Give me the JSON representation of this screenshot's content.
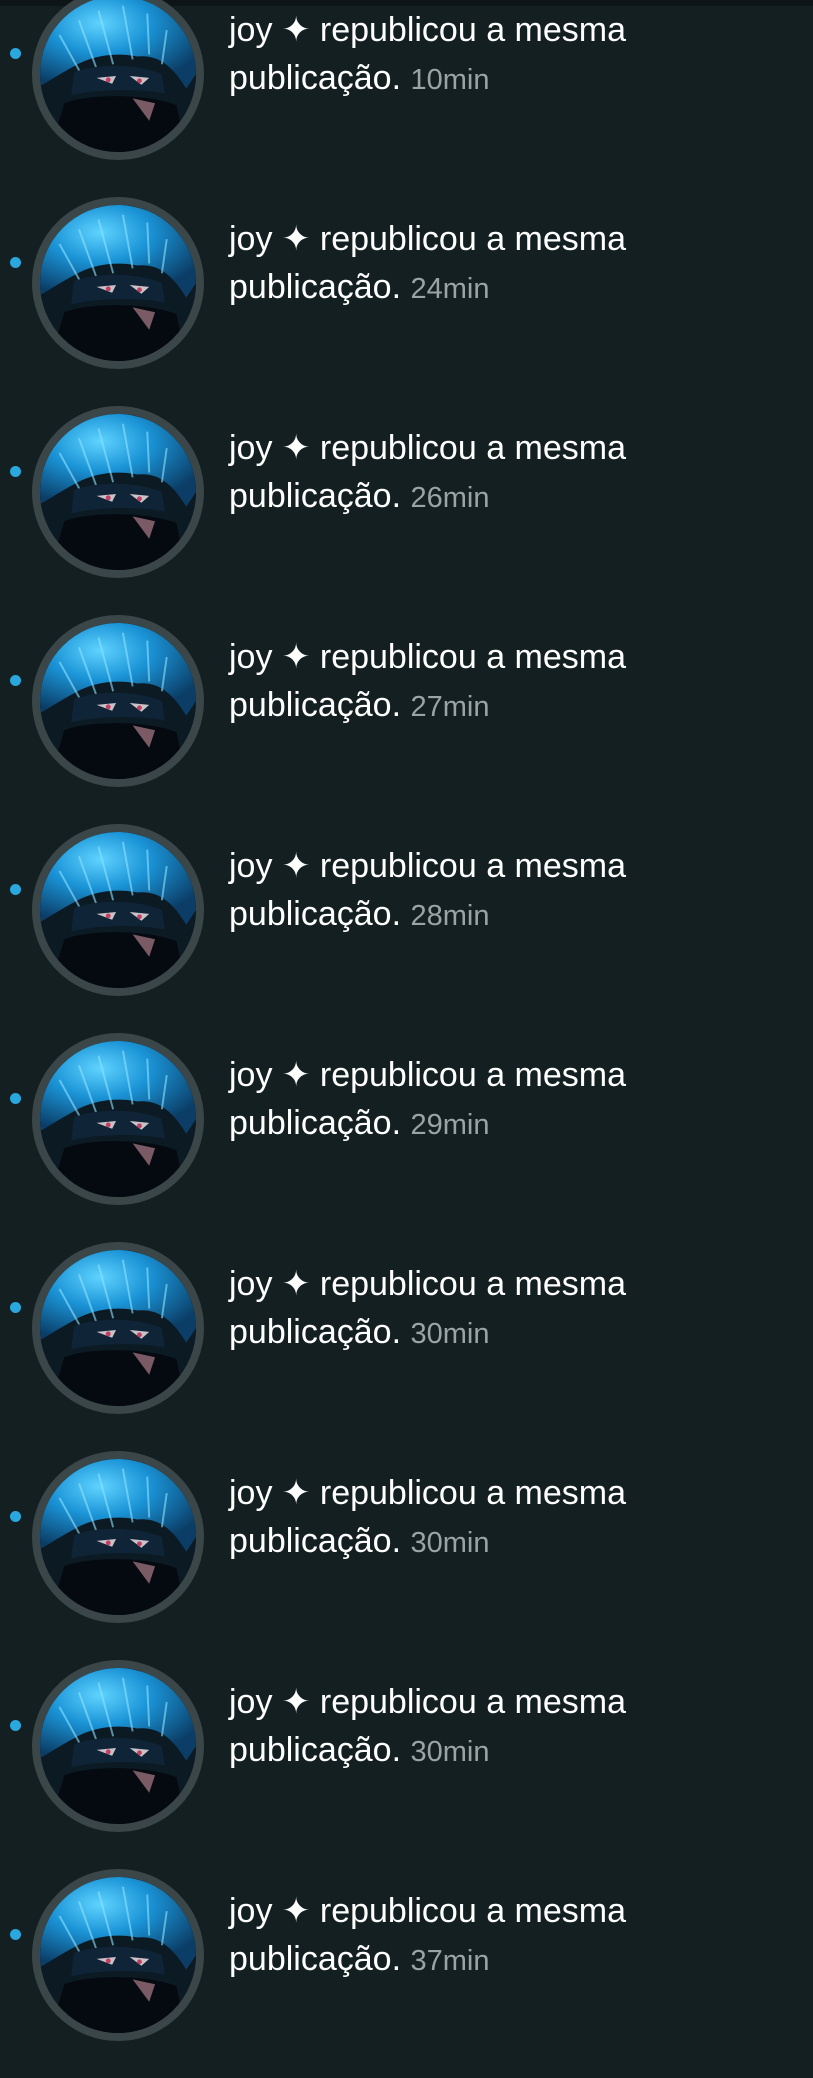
{
  "colors": {
    "background": "#141f21",
    "unread_dot": "#2aa7dc",
    "avatar_ring": "#3a4648",
    "text": "#ffffff",
    "timestamp": "#9aa3a5"
  },
  "notifications": [
    {
      "actor": "joy",
      "star": "✦",
      "action": " republicou a mesma",
      "object": "publicação.",
      "time": "10min",
      "unread": true,
      "avatar": "profile-avatar-icon"
    },
    {
      "actor": "joy",
      "star": "✦",
      "action": " republicou a mesma",
      "object": "publicação.",
      "time": "24min",
      "unread": true,
      "avatar": "profile-avatar-icon"
    },
    {
      "actor": "joy",
      "star": "✦",
      "action": " republicou a mesma",
      "object": "publicação.",
      "time": "26min",
      "unread": true,
      "avatar": "profile-avatar-icon"
    },
    {
      "actor": "joy",
      "star": "✦",
      "action": " republicou a mesma",
      "object": "publicação.",
      "time": "27min",
      "unread": true,
      "avatar": "profile-avatar-icon"
    },
    {
      "actor": "joy",
      "star": "✦",
      "action": " republicou a mesma",
      "object": "publicação.",
      "time": "28min",
      "unread": true,
      "avatar": "profile-avatar-icon"
    },
    {
      "actor": "joy",
      "star": "✦",
      "action": " republicou a mesma",
      "object": "publicação.",
      "time": "29min",
      "unread": true,
      "avatar": "profile-avatar-icon"
    },
    {
      "actor": "joy",
      "star": "✦",
      "action": " republicou a mesma",
      "object": "publicação.",
      "time": "30min",
      "unread": true,
      "avatar": "profile-avatar-icon"
    },
    {
      "actor": "joy",
      "star": "✦",
      "action": " republicou a mesma",
      "object": "publicação.",
      "time": "30min",
      "unread": true,
      "avatar": "profile-avatar-icon"
    },
    {
      "actor": "joy",
      "star": "✦",
      "action": " republicou a mesma",
      "object": "publicação.",
      "time": "30min",
      "unread": true,
      "avatar": "profile-avatar-icon"
    },
    {
      "actor": "joy",
      "star": "✦",
      "action": " republicou a mesma",
      "object": "publicação.",
      "time": "37min",
      "unread": true,
      "avatar": "profile-avatar-icon"
    }
  ]
}
